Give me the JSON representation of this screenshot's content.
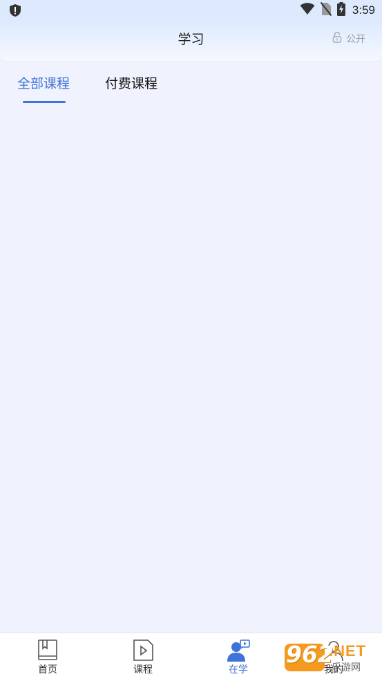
{
  "status_bar": {
    "time": "3:59",
    "icons": [
      "shield-alert-icon",
      "wifi-icon",
      "no-sim-icon",
      "battery-charging-icon"
    ]
  },
  "header": {
    "title": "学习",
    "visibility_label": "公开",
    "visibility_icon": "lock-open-icon"
  },
  "tabs": [
    {
      "label": "全部课程",
      "selected": true
    },
    {
      "label": "付费课程",
      "selected": false
    }
  ],
  "bottom_nav": [
    {
      "label": "首页",
      "icon": "book-icon",
      "active": false
    },
    {
      "label": "课程",
      "icon": "video-icon",
      "active": false
    },
    {
      "label": "在学",
      "icon": "user-study-icon",
      "active": true
    },
    {
      "label": "我的",
      "icon": "person-outline-icon",
      "active": false
    }
  ],
  "watermark": {
    "number": "962",
    "domain": ".NET",
    "text": "乐游网"
  },
  "colors": {
    "accent": "#3f73d8",
    "background": "#f0f3fe",
    "header_bg": "#ddeafe",
    "watermark_orange": "#f39a1f"
  }
}
